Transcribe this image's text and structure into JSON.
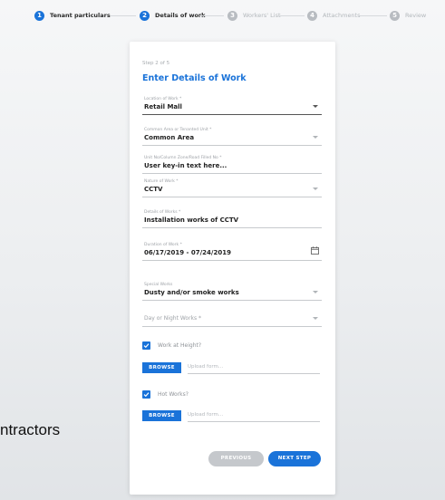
{
  "stepper": {
    "steps": [
      {
        "num": "1",
        "label": "Tenant particulars",
        "active": true
      },
      {
        "num": "2",
        "label": "Details of work",
        "active": true
      },
      {
        "num": "3",
        "label": "Workers' List",
        "active": false
      },
      {
        "num": "4",
        "label": "Attachments",
        "active": false
      },
      {
        "num": "5",
        "label": "Review",
        "active": false
      }
    ]
  },
  "form": {
    "step_count": "Step 2 of 5",
    "title": "Enter Details of Work",
    "fields": {
      "location": {
        "label": "Location of Work *",
        "value": "Retail Mall"
      },
      "area": {
        "label": "Common Area or Tenanted Unit *",
        "value": "Common Area"
      },
      "unit": {
        "label": "Unit No/Column Zone/Road Filled No *",
        "value": "User key-in text here..."
      },
      "nature": {
        "label": "Nature of Work *",
        "value": "CCTV"
      },
      "details": {
        "label": "Details of Works *",
        "value": "Installation works of CCTV"
      },
      "duration": {
        "label": "Duration of Work *",
        "value": "06/17/2019 - 07/24/2019"
      },
      "special": {
        "label": "Special Works",
        "value": "Dusty and/or smoke works"
      },
      "day_night": {
        "placeholder": "Day or Night Works *"
      }
    },
    "height_check": {
      "label": "Work at Height?",
      "checked": true
    },
    "height_upload": {
      "button": "BROWSE",
      "placeholder": "Upload form..."
    },
    "hot_check": {
      "label": "Hot Works?",
      "checked": true
    },
    "hot_upload": {
      "button": "BROWSE",
      "placeholder": "Upload form..."
    },
    "prev_label": "PREVIOUS",
    "next_label": "NEXT STEP"
  },
  "overlay_text": "ntractors",
  "colors": {
    "accent": "#1a73d9",
    "disabled": "#c5c8cc"
  },
  "icons": {
    "calendar": "calendar-icon",
    "dropdown": "chevron-down-icon",
    "check": "check-icon"
  }
}
